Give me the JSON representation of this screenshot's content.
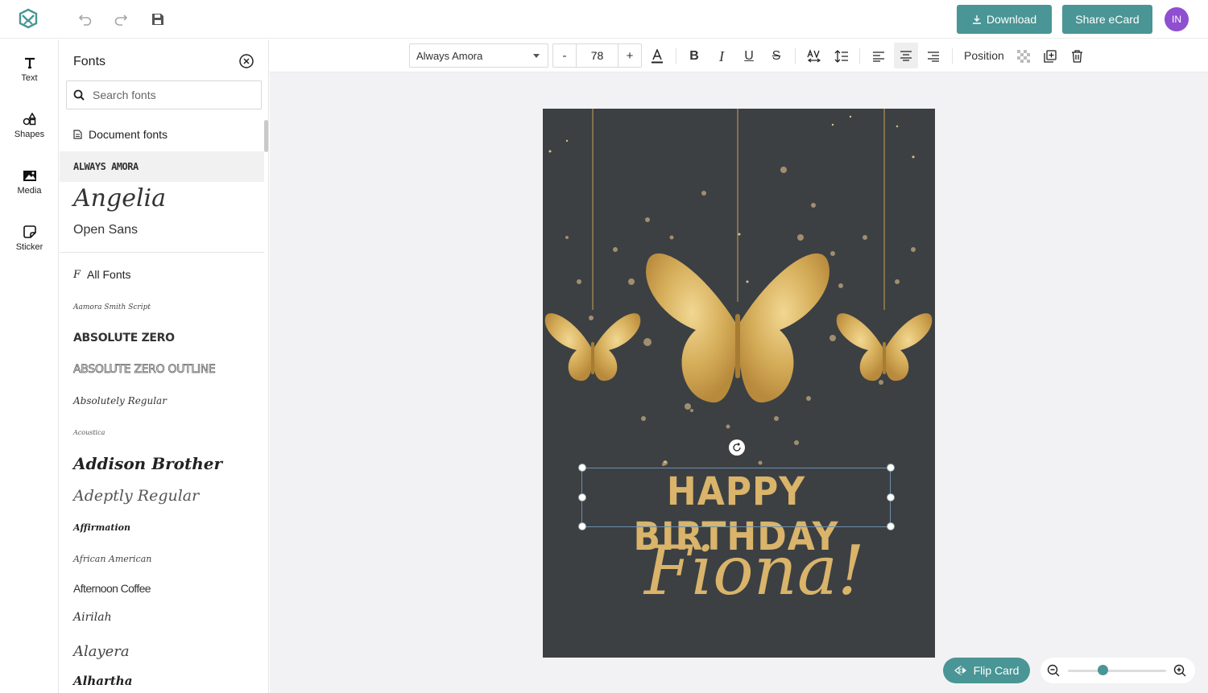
{
  "topbar": {
    "download_label": "Download",
    "share_label": "Share eCard",
    "avatar_initials": "IN"
  },
  "rail": {
    "items": [
      {
        "label": "Text",
        "icon": "text-icon"
      },
      {
        "label": "Shapes",
        "icon": "shapes-icon"
      },
      {
        "label": "Media",
        "icon": "media-icon"
      },
      {
        "label": "Sticker",
        "icon": "sticker-icon"
      }
    ]
  },
  "panel": {
    "title": "Fonts",
    "search_placeholder": "Search fonts",
    "document_fonts_label": "Document fonts",
    "document_fonts": [
      "ALWAYS AMORA",
      "Angelia",
      "Open Sans"
    ],
    "all_fonts_label": "All Fonts",
    "all_fonts": [
      "Aamora Smith Script",
      "ABSOLUTE ZERO",
      "ABSOLUTE ZERO OUTLINE",
      "Absolutely Regular",
      "Acoustica",
      "Addison Brother",
      "Adeptly Regular",
      "Affirmation",
      "African American",
      "Afternoon Coffee",
      "Airilah",
      "Alayera",
      "Alhartha"
    ]
  },
  "toolbar": {
    "font_family": "Always Amora",
    "font_size": "78",
    "minus": "-",
    "plus": "+",
    "position_label": "Position"
  },
  "card": {
    "headline": "HAPPY BIRTHDAY",
    "name": "Fiona!",
    "background_color": "#3c4043",
    "gold_color": "#d9b46a"
  },
  "bottom": {
    "flip_label": "Flip Card",
    "zoom_level": 0.35
  },
  "colors": {
    "accent": "#4a9595",
    "avatar": "#8f4fd0"
  }
}
